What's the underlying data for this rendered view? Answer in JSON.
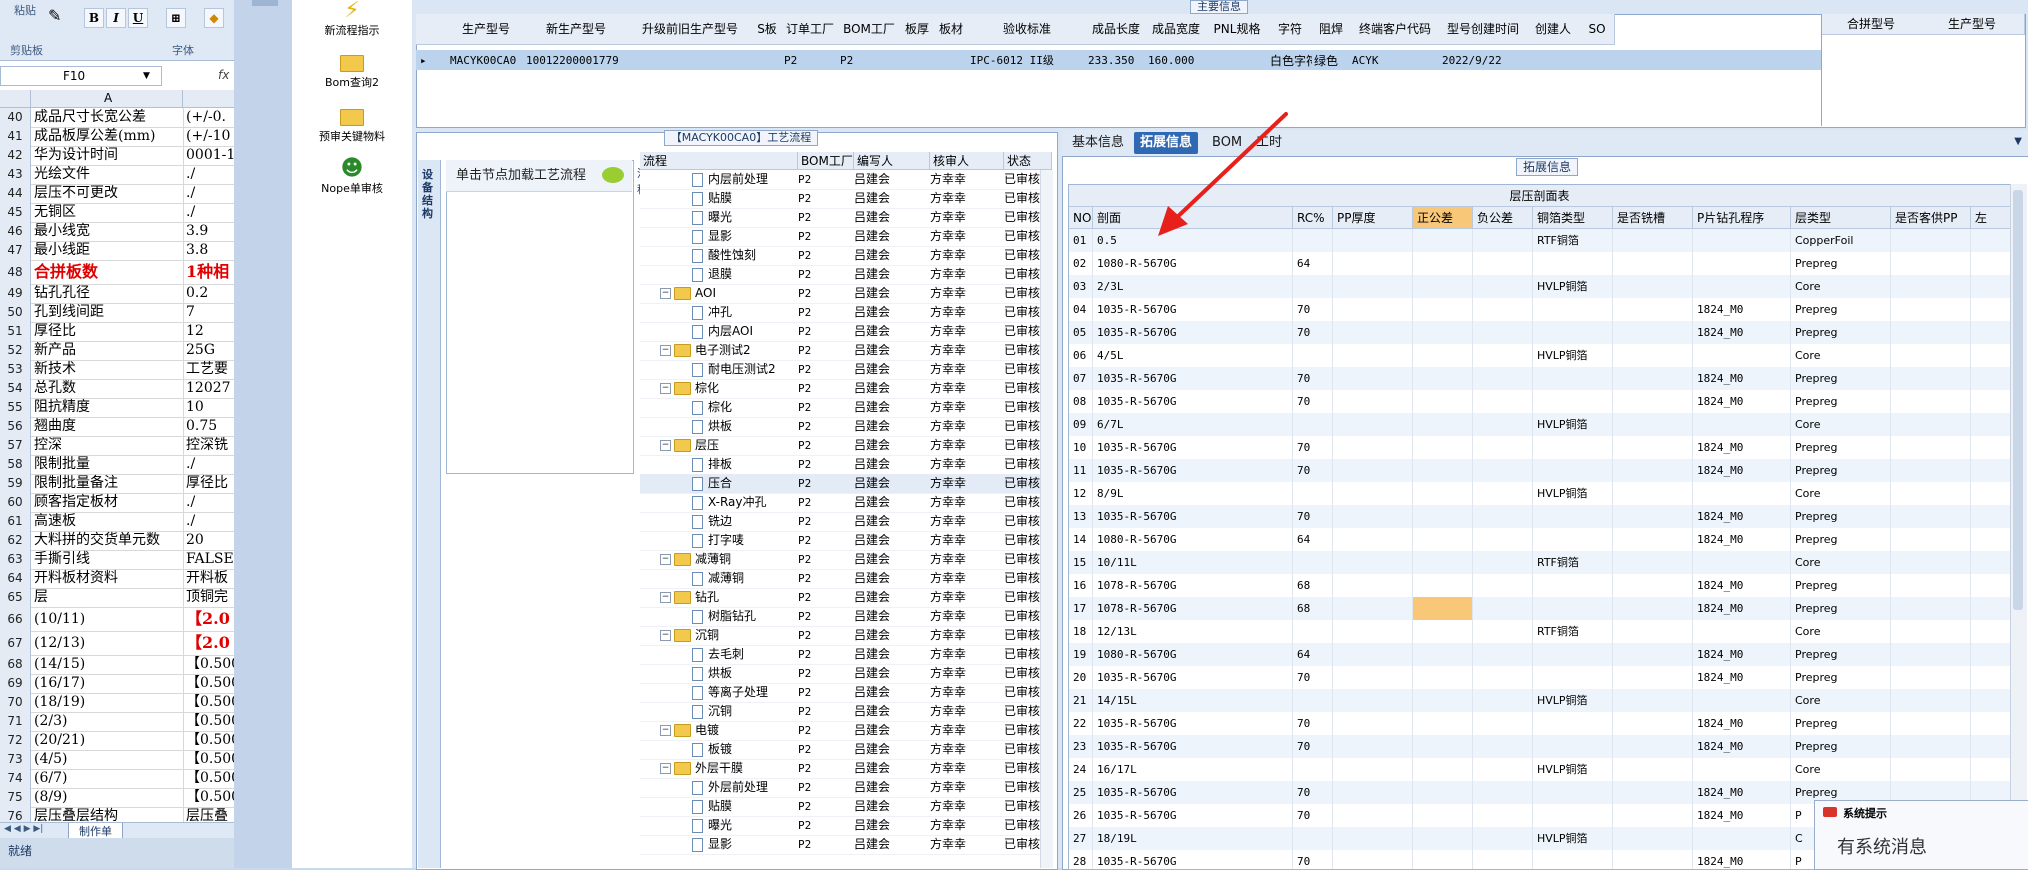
{
  "excel": {
    "ribbon": {
      "paste_label": "粘贴",
      "clipboard_label": "剪贴板",
      "font_label": "字体",
      "bold": "B",
      "italic": "I",
      "underline": "U"
    },
    "name_box": "F10",
    "fx": "fx",
    "col_a": "A",
    "rows": [
      {
        "n": "40",
        "a": "成品尺寸长宽公差",
        "b": "(+/-0."
      },
      {
        "n": "41",
        "a": "成品板厚公差(mm)",
        "b": "(+/-10"
      },
      {
        "n": "42",
        "a": "华为设计时间",
        "b": "0001-1"
      },
      {
        "n": "43",
        "a": "光绘文件",
        "b": "./"
      },
      {
        "n": "44",
        "a": "层压不可更改",
        "b": "./"
      },
      {
        "n": "45",
        "a": "无铜区",
        "b": "./"
      },
      {
        "n": "46",
        "a": "最小线宽",
        "b": "3.9"
      },
      {
        "n": "47",
        "a": "最小线距",
        "b": "3.8"
      },
      {
        "n": "48",
        "a": "合拼板数",
        "b": "1种相",
        "red": true
      },
      {
        "n": "49",
        "a": "钻孔孔径",
        "b": "0.2"
      },
      {
        "n": "50",
        "a": "孔到线间距",
        "b": "7"
      },
      {
        "n": "51",
        "a": "厚径比",
        "b": "12"
      },
      {
        "n": "52",
        "a": "新产品",
        "b": "25G"
      },
      {
        "n": "53",
        "a": "新技术",
        "b": "工艺要"
      },
      {
        "n": "54",
        "a": "总孔数",
        "b": "12027"
      },
      {
        "n": "55",
        "a": "阻抗精度",
        "b": "10"
      },
      {
        "n": "56",
        "a": "翘曲度",
        "b": "0.75"
      },
      {
        "n": "57",
        "a": "控深",
        "b": "控深铣"
      },
      {
        "n": "58",
        "a": "限制批量",
        "b": "./"
      },
      {
        "n": "59",
        "a": "限制批量备注",
        "b": "厚径比"
      },
      {
        "n": "60",
        "a": "顾客指定板材",
        "b": "./"
      },
      {
        "n": "61",
        "a": "高速板",
        "b": "./"
      },
      {
        "n": "62",
        "a": "大料拼的交货单元数",
        "b": "20"
      },
      {
        "n": "63",
        "a": "手撕引线",
        "b": "FALSE"
      },
      {
        "n": "64",
        "a": "开料板材资料",
        "b": "开料板"
      },
      {
        "n": "65",
        "a": "层",
        "b": "顶铜完"
      },
      {
        "n": "66",
        "a": "(10/11)",
        "b": "【2.0",
        "red2": true
      },
      {
        "n": "67",
        "a": "(12/13)",
        "b": "【2.0",
        "red2": true
      },
      {
        "n": "68",
        "a": "(14/15)",
        "b": "【0.500"
      },
      {
        "n": "69",
        "a": "(16/17)",
        "b": "【0.500"
      },
      {
        "n": "70",
        "a": "(18/19)",
        "b": "【0.500"
      },
      {
        "n": "71",
        "a": "(2/3)",
        "b": "【0.500"
      },
      {
        "n": "72",
        "a": "(20/21)",
        "b": "【0.500"
      },
      {
        "n": "73",
        "a": "(4/5)",
        "b": "【0.500"
      },
      {
        "n": "74",
        "a": "(6/7)",
        "b": "【0.500"
      },
      {
        "n": "75",
        "a": "(8/9)",
        "b": "【0.500"
      },
      {
        "n": "76",
        "a": "层压叠层结构",
        "b": "层压叠"
      }
    ],
    "sheet_tab": "制作单",
    "status": "就绪"
  },
  "launcher": [
    {
      "label": "新流程指示",
      "icon": "lightning-icon"
    },
    {
      "label": "Bom查询2",
      "icon": "folder-icon"
    },
    {
      "label": "预审关键物料",
      "icon": "folder-icon"
    },
    {
      "label": "Nope单审核",
      "icon": "user-icon"
    }
  ],
  "main_info": {
    "title": "主要信息",
    "columns": [
      "生产型号",
      "新生产型号",
      "升级前旧生产型号",
      "S板",
      "订单工厂",
      "BOM工厂",
      "板厚",
      "板材",
      "验收标准",
      "成品长度",
      "成品宽度",
      "PNL规格",
      "字符",
      "阻焊",
      "终端客户代码",
      "型号创建时间",
      "创建人",
      "SO"
    ],
    "row": [
      "MACYK00CA0",
      "10012200001779",
      "",
      "",
      "P2",
      "P2",
      "",
      "",
      "IPC-6012 II级",
      "233.350",
      "160.000",
      "",
      "白色字符",
      "绿色",
      "ACYK",
      "2022/9/22",
      "",
      ""
    ],
    "side_columns": [
      "合拼型号",
      "生产型号"
    ]
  },
  "flow": {
    "title": "【MACYK00CA0】工艺流程",
    "hint": "单击节点加载工艺流程",
    "vertical_tab": "设备结构",
    "strip_label": "流程",
    "columns": [
      "流程",
      "BOM工厂",
      "编写人",
      "核审人",
      "状态"
    ],
    "rows": [
      {
        "name": "内层前处理",
        "lvl": 2,
        "f": "P2",
        "w": "吕建会",
        "r": "方幸幸",
        "s": "已审核"
      },
      {
        "name": "贴膜",
        "lvl": 2,
        "f": "P2",
        "w": "吕建会",
        "r": "方幸幸",
        "s": "已审核"
      },
      {
        "name": "曝光",
        "lvl": 2,
        "f": "P2",
        "w": "吕建会",
        "r": "方幸幸",
        "s": "已审核"
      },
      {
        "name": "显影",
        "lvl": 2,
        "f": "P2",
        "w": "吕建会",
        "r": "方幸幸",
        "s": "已审核"
      },
      {
        "name": "酸性蚀刻",
        "lvl": 2,
        "f": "P2",
        "w": "吕建会",
        "r": "方幸幸",
        "s": "已审核"
      },
      {
        "name": "退膜",
        "lvl": 2,
        "f": "P2",
        "w": "吕建会",
        "r": "方幸幸",
        "s": "已审核"
      },
      {
        "name": "AOI",
        "lvl": 1,
        "f": "P2",
        "w": "吕建会",
        "r": "方幸幸",
        "s": "已审核"
      },
      {
        "name": "冲孔",
        "lvl": 2,
        "f": "P2",
        "w": "吕建会",
        "r": "方幸幸",
        "s": "已审核"
      },
      {
        "name": "内层AOI",
        "lvl": 2,
        "f": "P2",
        "w": "吕建会",
        "r": "方幸幸",
        "s": "已审核"
      },
      {
        "name": "电子测试2",
        "lvl": 1,
        "f": "P2",
        "w": "吕建会",
        "r": "方幸幸",
        "s": "已审核"
      },
      {
        "name": "耐电压测试2",
        "lvl": 2,
        "f": "P2",
        "w": "吕建会",
        "r": "方幸幸",
        "s": "已审核"
      },
      {
        "name": "棕化",
        "lvl": 1,
        "f": "P2",
        "w": "吕建会",
        "r": "方幸幸",
        "s": "已审核"
      },
      {
        "name": "棕化",
        "lvl": 2,
        "f": "P2",
        "w": "吕建会",
        "r": "方幸幸",
        "s": "已审核"
      },
      {
        "name": "烘板",
        "lvl": 2,
        "f": "P2",
        "w": "吕建会",
        "r": "方幸幸",
        "s": "已审核"
      },
      {
        "name": "层压",
        "lvl": 1,
        "f": "P2",
        "w": "吕建会",
        "r": "方幸幸",
        "s": "已审核"
      },
      {
        "name": "排板",
        "lvl": 2,
        "f": "P2",
        "w": "吕建会",
        "r": "方幸幸",
        "s": "已审核"
      },
      {
        "name": "压合",
        "lvl": 2,
        "f": "P2",
        "w": "吕建会",
        "r": "方幸幸",
        "s": "已审核",
        "sel": true
      },
      {
        "name": "X-Ray冲孔",
        "lvl": 2,
        "f": "P2",
        "w": "吕建会",
        "r": "方幸幸",
        "s": "已审核"
      },
      {
        "name": "铣边",
        "lvl": 2,
        "f": "P2",
        "w": "吕建会",
        "r": "方幸幸",
        "s": "已审核"
      },
      {
        "name": "打字唛",
        "lvl": 2,
        "f": "P2",
        "w": "吕建会",
        "r": "方幸幸",
        "s": "已审核"
      },
      {
        "name": "减薄铜",
        "lvl": 1,
        "f": "P2",
        "w": "吕建会",
        "r": "方幸幸",
        "s": "已审核"
      },
      {
        "name": "减薄铜",
        "lvl": 2,
        "f": "P2",
        "w": "吕建会",
        "r": "方幸幸",
        "s": "已审核"
      },
      {
        "name": "钻孔",
        "lvl": 1,
        "f": "P2",
        "w": "吕建会",
        "r": "方幸幸",
        "s": "已审核"
      },
      {
        "name": "树脂钻孔",
        "lvl": 2,
        "f": "P2",
        "w": "吕建会",
        "r": "方幸幸",
        "s": "已审核"
      },
      {
        "name": "沉铜",
        "lvl": 1,
        "f": "P2",
        "w": "吕建会",
        "r": "方幸幸",
        "s": "已审核"
      },
      {
        "name": "去毛刺",
        "lvl": 2,
        "f": "P2",
        "w": "吕建会",
        "r": "方幸幸",
        "s": "已审核"
      },
      {
        "name": "烘板",
        "lvl": 2,
        "f": "P2",
        "w": "吕建会",
        "r": "方幸幸",
        "s": "已审核"
      },
      {
        "name": "等离子处理",
        "lvl": 2,
        "f": "P2",
        "w": "吕建会",
        "r": "方幸幸",
        "s": "已审核"
      },
      {
        "name": "沉铜",
        "lvl": 2,
        "f": "P2",
        "w": "吕建会",
        "r": "方幸幸",
        "s": "已审核"
      },
      {
        "name": "电镀",
        "lvl": 1,
        "f": "P2",
        "w": "吕建会",
        "r": "方幸幸",
        "s": "已审核"
      },
      {
        "name": "板镀",
        "lvl": 2,
        "f": "P2",
        "w": "吕建会",
        "r": "方幸幸",
        "s": "已审核"
      },
      {
        "name": "外层干膜",
        "lvl": 1,
        "f": "P2",
        "w": "吕建会",
        "r": "方幸幸",
        "s": "已审核"
      },
      {
        "name": "外层前处理",
        "lvl": 2,
        "f": "P2",
        "w": "吕建会",
        "r": "方幸幸",
        "s": "已审核"
      },
      {
        "name": "贴膜",
        "lvl": 2,
        "f": "P2",
        "w": "吕建会",
        "r": "方幸幸",
        "s": "已审核"
      },
      {
        "name": "曝光",
        "lvl": 2,
        "f": "P2",
        "w": "吕建会",
        "r": "方幸幸",
        "s": "已审核"
      },
      {
        "name": "显影",
        "lvl": 2,
        "f": "P2",
        "w": "吕建会",
        "r": "方幸幸",
        "s": "已审核"
      }
    ]
  },
  "detail": {
    "tabs": [
      "基本信息",
      "拓展信息",
      "BOM",
      "工时"
    ],
    "active_tab": 1,
    "group_title": "拓展信息",
    "grid_title": "层压剖面表",
    "columns": [
      "NO",
      "剖面",
      "RC%",
      "PP厚度",
      "正公差",
      "负公差",
      "铜箔类型",
      "是否铣槽",
      "P片钻孔程序",
      "层类型",
      "是否客供PP",
      "左"
    ],
    "rows": [
      [
        "01",
        "0.5",
        "",
        "",
        "",
        "",
        "RTF铜箔",
        "",
        "",
        "CopperFoil",
        "",
        ""
      ],
      [
        "02",
        "1080-R-5670G",
        "64",
        "",
        "",
        "",
        "",
        "",
        "",
        "Prepreg",
        "",
        ""
      ],
      [
        "03",
        "2/3L",
        "",
        "",
        "",
        "",
        "HVLP铜箔",
        "",
        "",
        "Core",
        "",
        ""
      ],
      [
        "04",
        "1035-R-5670G",
        "70",
        "",
        "",
        "",
        "",
        "",
        "1824_M0",
        "Prepreg",
        "",
        ""
      ],
      [
        "05",
        "1035-R-5670G",
        "70",
        "",
        "",
        "",
        "",
        "",
        "1824_M0",
        "Prepreg",
        "",
        ""
      ],
      [
        "06",
        "4/5L",
        "",
        "",
        "",
        "",
        "HVLP铜箔",
        "",
        "",
        "Core",
        "",
        ""
      ],
      [
        "07",
        "1035-R-5670G",
        "70",
        "",
        "",
        "",
        "",
        "",
        "1824_M0",
        "Prepreg",
        "",
        ""
      ],
      [
        "08",
        "1035-R-5670G",
        "70",
        "",
        "",
        "",
        "",
        "",
        "1824_M0",
        "Prepreg",
        "",
        ""
      ],
      [
        "09",
        "6/7L",
        "",
        "",
        "",
        "",
        "HVLP铜箔",
        "",
        "",
        "Core",
        "",
        ""
      ],
      [
        "10",
        "1035-R-5670G",
        "70",
        "",
        "",
        "",
        "",
        "",
        "1824_M0",
        "Prepreg",
        "",
        ""
      ],
      [
        "11",
        "1035-R-5670G",
        "70",
        "",
        "",
        "",
        "",
        "",
        "1824_M0",
        "Prepreg",
        "",
        ""
      ],
      [
        "12",
        "8/9L",
        "",
        "",
        "",
        "",
        "HVLP铜箔",
        "",
        "",
        "Core",
        "",
        ""
      ],
      [
        "13",
        "1035-R-5670G",
        "70",
        "",
        "",
        "",
        "",
        "",
        "1824_M0",
        "Prepreg",
        "",
        ""
      ],
      [
        "14",
        "1080-R-5670G",
        "64",
        "",
        "",
        "",
        "",
        "",
        "1824_M0",
        "Prepreg",
        "",
        ""
      ],
      [
        "15",
        "10/11L",
        "",
        "",
        "",
        "",
        "RTF铜箔",
        "",
        "",
        "Core",
        "",
        ""
      ],
      [
        "16",
        "1078-R-5670G",
        "68",
        "",
        "",
        "",
        "",
        "",
        "1824_M0",
        "Prepreg",
        "",
        ""
      ],
      [
        "17",
        "1078-R-5670G",
        "68",
        "",
        "",
        "",
        "",
        "",
        "1824_M0",
        "Prepreg",
        "",
        ""
      ],
      [
        "18",
        "12/13L",
        "",
        "",
        "",
        "",
        "RTF铜箔",
        "",
        "",
        "Core",
        "",
        ""
      ],
      [
        "19",
        "1080-R-5670G",
        "64",
        "",
        "",
        "",
        "",
        "",
        "1824_M0",
        "Prepreg",
        "",
        ""
      ],
      [
        "20",
        "1035-R-5670G",
        "70",
        "",
        "",
        "",
        "",
        "",
        "1824_M0",
        "Prepreg",
        "",
        ""
      ],
      [
        "21",
        "14/15L",
        "",
        "",
        "",
        "",
        "HVLP铜箔",
        "",
        "",
        "Core",
        "",
        ""
      ],
      [
        "22",
        "1035-R-5670G",
        "70",
        "",
        "",
        "",
        "",
        "",
        "1824_M0",
        "Prepreg",
        "",
        ""
      ],
      [
        "23",
        "1035-R-5670G",
        "70",
        "",
        "",
        "",
        "",
        "",
        "1824_M0",
        "Prepreg",
        "",
        ""
      ],
      [
        "24",
        "16/17L",
        "",
        "",
        "",
        "",
        "HVLP铜箔",
        "",
        "",
        "Core",
        "",
        ""
      ],
      [
        "25",
        "1035-R-5670G",
        "70",
        "",
        "",
        "",
        "",
        "",
        "1824_M0",
        "Prepreg",
        "",
        ""
      ],
      [
        "26",
        "1035-R-5670G",
        "70",
        "",
        "",
        "",
        "",
        "",
        "1824_M0",
        "P",
        "",
        ""
      ],
      [
        "27",
        "18/19L",
        "",
        "",
        "",
        "",
        "HVLP铜箔",
        "",
        "",
        "C",
        "",
        ""
      ],
      [
        "28",
        "1035-R-5670G",
        "70",
        "",
        "",
        "",
        "",
        "",
        "1824_M0",
        "P",
        "",
        ""
      ]
    ]
  },
  "notification": {
    "title": "系统提示",
    "message": "有系统消息"
  },
  "colors": {
    "accent": "#2f68b3",
    "highlight_cell": "#f8c878",
    "arrow": "#e8201c"
  }
}
